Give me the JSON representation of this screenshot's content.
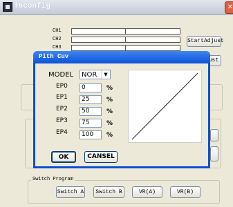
{
  "main_window": {
    "title": "T6config",
    "close_glyph": "✕",
    "channels": [
      {
        "label": "CH1"
      },
      {
        "label": "CH2"
      },
      {
        "label": "CH3"
      }
    ],
    "start_adjust_label": "StartAdjust",
    "partial_button_label": "ust",
    "switch_program": {
      "label": "Switch Program",
      "buttons": [
        "Switch A",
        "Switch B",
        "VR(A)",
        "VR(B)"
      ]
    }
  },
  "dialog": {
    "title": "Pith Cuv",
    "model_label": "MODEL",
    "model_value": "NOR",
    "dropdown_glyph": "▼",
    "points": [
      {
        "label": "EP0",
        "value": "0",
        "unit": "%"
      },
      {
        "label": "EP1",
        "value": "25",
        "unit": "%"
      },
      {
        "label": "EP2",
        "value": "50",
        "unit": "%"
      },
      {
        "label": "EP3",
        "value": "75",
        "unit": "%"
      },
      {
        "label": "EP4",
        "value": "100",
        "unit": "%"
      }
    ],
    "ok_label": "OK",
    "cancel_label": "CANSEL"
  }
}
